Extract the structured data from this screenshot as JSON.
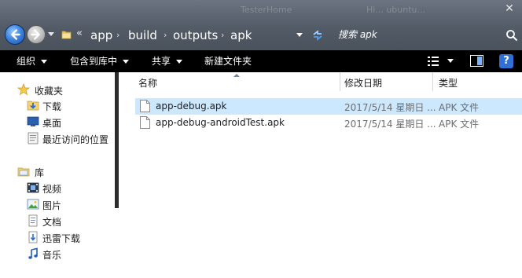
{
  "window": {
    "ghost_title": "TesterHome",
    "ghost_right": "Hi... ubuntu...",
    "close_label": "✕"
  },
  "address": {
    "chevron": "«",
    "crumbs": [
      "app",
      "build",
      "outputs",
      "apk"
    ],
    "separator": "›"
  },
  "search": {
    "placeholder": "搜索 apk"
  },
  "toolbar": {
    "organize": "组织",
    "include_in_library": "包含到库中",
    "share": "共享",
    "new_folder": "新建文件夹",
    "help": "?"
  },
  "nav": {
    "favorites": "收藏夹",
    "downloads": "下载",
    "desktop": "桌面",
    "recent": "最近访问的位置",
    "libraries": "库",
    "videos": "视频",
    "pictures": "图片",
    "documents": "文档",
    "xunlei": "迅雷下载",
    "music": "音乐"
  },
  "columns": {
    "name": "名称",
    "modified": "修改日期",
    "type": "类型"
  },
  "files": [
    {
      "name": "app-debug.apk",
      "modified": "2017/5/14 星期日 ...",
      "type": "APK 文件",
      "selected": true
    },
    {
      "name": "app-debug-androidTest.apk",
      "modified": "2017/5/14 星期日 ...",
      "type": "APK 文件",
      "selected": false
    }
  ],
  "colors": {
    "selection": "#cce8ff",
    "toolbar_bg": "#000000",
    "titlebar_bg": "#525b66"
  }
}
